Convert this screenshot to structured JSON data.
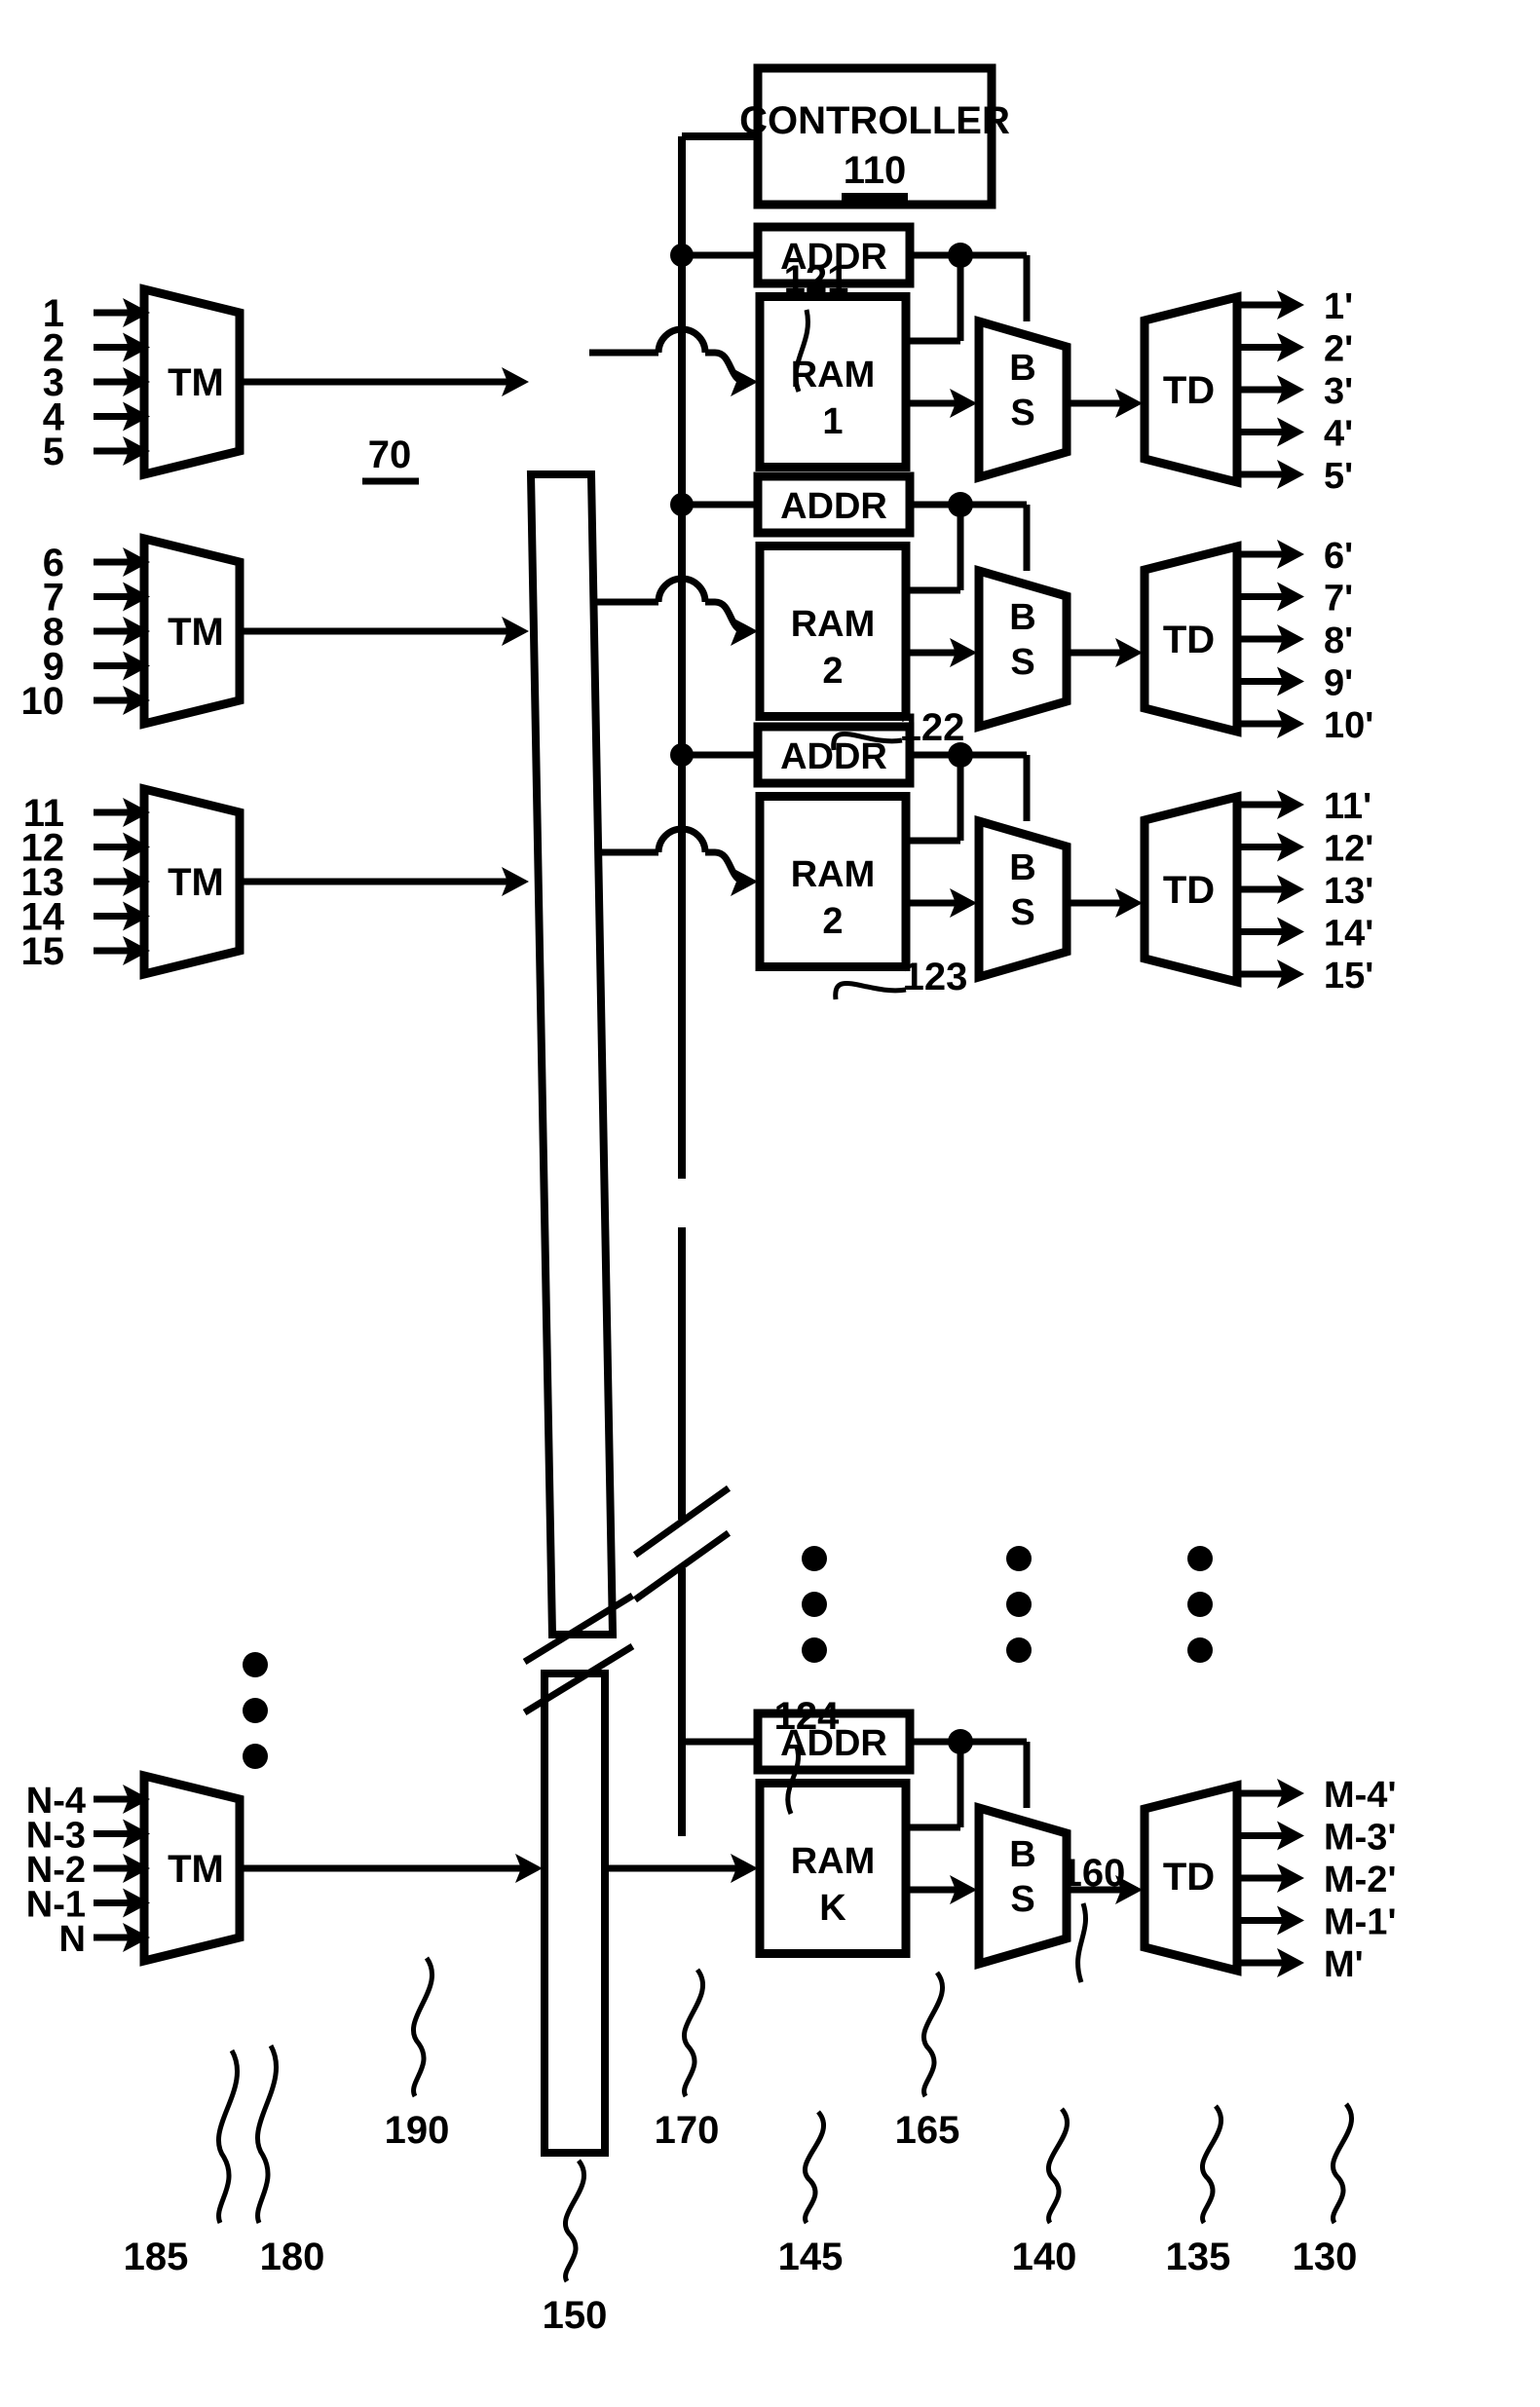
{
  "figure": {
    "kind": "patent-block-diagram",
    "stroke_color": "#000000",
    "background_color": "#ffffff"
  },
  "controller": {
    "title": "CONTROLLER",
    "ref": "110"
  },
  "bus": {
    "label_70": "70",
    "ref_150": "150",
    "ref_190": "190",
    "ref_170": "170"
  },
  "rows": [
    {
      "inputs": [
        "1",
        "2",
        "3",
        "4",
        "5"
      ],
      "mux_label": "TM",
      "addr_label": "ADDR",
      "addr_ref": "121",
      "ram_line1": "RAM",
      "ram_line2": "1",
      "bs_line1": "B",
      "bs_line2": "S",
      "demux_label": "TD",
      "outputs": [
        "1'",
        "2'",
        "3'",
        "4'",
        "5'"
      ]
    },
    {
      "inputs": [
        "6",
        "7",
        "8",
        "9",
        "10"
      ],
      "mux_label": "TM",
      "addr_label": "ADDR",
      "addr_ref": "122",
      "ram_line1": "RAM",
      "ram_line2": "2",
      "bs_line1": "B",
      "bs_line2": "S",
      "demux_label": "TD",
      "outputs": [
        "6'",
        "7'",
        "8'",
        "9'",
        "10'"
      ]
    },
    {
      "inputs": [
        "11",
        "12",
        "13",
        "14",
        "15"
      ],
      "mux_label": "TM",
      "addr_label": "ADDR",
      "addr_ref": "123",
      "ram_line1": "RAM",
      "ram_line2": "2",
      "bs_line1": "B",
      "bs_line2": "S",
      "demux_label": "TD",
      "outputs": [
        "11'",
        "12'",
        "13'",
        "14'",
        "15'"
      ]
    },
    {
      "inputs": [
        "N-4",
        "N-3",
        "N-2",
        "N-1",
        "N"
      ],
      "mux_label": "TM",
      "addr_label": "ADDR",
      "addr_ref": "124",
      "ram_line1": "RAM",
      "ram_line2": "K",
      "bs_line1": "B",
      "bs_line2": "S",
      "demux_label": "TD",
      "outputs": [
        "M-4'",
        "M-3'",
        "M-2'",
        "M-1'",
        "M'"
      ]
    }
  ],
  "refs": {
    "r185": "185",
    "r180": "180",
    "r190": "190",
    "r150": "150",
    "r170": "170",
    "r145": "145",
    "r165": "165",
    "r140": "140",
    "r160": "160",
    "r135": "135",
    "r130": "130"
  }
}
